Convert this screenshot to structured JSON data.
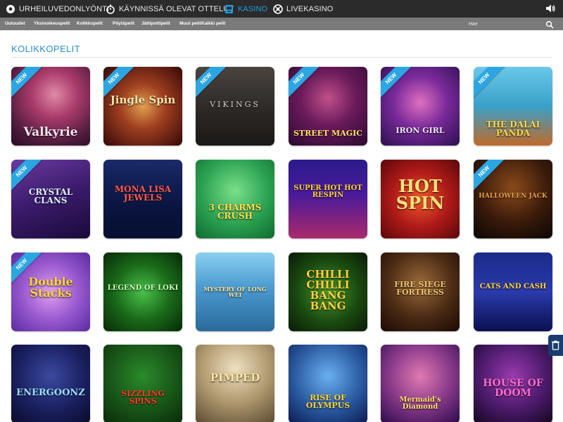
{
  "top_nav": {
    "items": [
      {
        "label": "URHEILUVEDONLYÖNTI",
        "icon": "soccer-ball-icon"
      },
      {
        "label": "KÄYNNISSÄ OLEVAT OTTELUT",
        "icon": "stopwatch-icon"
      },
      {
        "label": "KASINO",
        "icon": "slot-machine-icon",
        "active": true
      },
      {
        "label": "LIVEKASINO",
        "icon": "roulette-icon"
      }
    ],
    "sound_icon": "speaker-icon"
  },
  "sub_nav": {
    "items": [
      "Uutuudet",
      "Yksinoikeuspelit",
      "Kolikkopelit",
      "Pöytäpelit",
      "Jättipottipelit",
      "Muut pelit",
      "Kaikki pelit"
    ],
    "search_placeholder": "Hae"
  },
  "section": {
    "title": "KOLIKKOPELIT"
  },
  "badge_label": "NEW",
  "games": [
    {
      "title": "Valkyrie",
      "is_new": true
    },
    {
      "title": "Jingle Spin",
      "is_new": true
    },
    {
      "title": "VIKINGS",
      "is_new": true
    },
    {
      "title": "STREET MAGIC",
      "is_new": true
    },
    {
      "title": "IRON GIRL",
      "is_new": true
    },
    {
      "title": "THE DALAI PANDA",
      "is_new": true
    },
    {
      "title": "CRYSTAL CLANS",
      "is_new": true
    },
    {
      "title": "MONA LISA JEWELS",
      "is_new": false
    },
    {
      "title": "3 CHARMS CRUSH",
      "is_new": false
    },
    {
      "title": "SUPER HOT HOT RESPIN",
      "is_new": false
    },
    {
      "title": "HOT SPIN",
      "is_new": false
    },
    {
      "title": "HALLOWEEN JACK",
      "is_new": true
    },
    {
      "title": "Double Stacks",
      "is_new": true
    },
    {
      "title": "LEGEND OF LOKI",
      "is_new": false
    },
    {
      "title": "MYSTERY OF LONG WEI",
      "is_new": false
    },
    {
      "title": "CHILLI CHILLI BANG BANG",
      "is_new": false
    },
    {
      "title": "FIRE SIEGE FORTRESS",
      "is_new": false
    },
    {
      "title": "CATS AND CASH",
      "is_new": false
    },
    {
      "title": "ENERGOONZ",
      "is_new": false
    },
    {
      "title": "SIZZLING SPINS",
      "is_new": false
    },
    {
      "title": "PIMPED",
      "is_new": false
    },
    {
      "title": "RISE OF OLYMPUS",
      "is_new": false
    },
    {
      "title": "Mermaid's Diamond",
      "is_new": false
    },
    {
      "title": "HOUSE OF DOOM",
      "is_new": false
    }
  ],
  "colors": {
    "top_nav_bg": "#2b2b2b",
    "sub_nav_bg": "#7a7a7a",
    "accent": "#1e9fe0",
    "title": "#2a8ec8",
    "new_badge": "#2ba6e2",
    "side_tab": "#1a3d6e"
  },
  "side_tab_icon": "trash-icon"
}
